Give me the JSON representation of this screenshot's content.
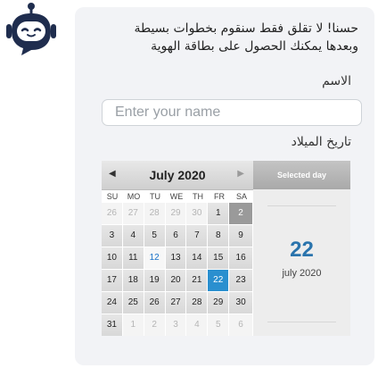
{
  "bot": {
    "avatar_icon": "robot-icon"
  },
  "message": {
    "line1": "حسنا! لا تقلق فقط سنقوم بخطوات بسيطة",
    "line2": "وبعدها يمكنك الحصول على بطاقة الهوية"
  },
  "form": {
    "name_label": "الاسم",
    "name_placeholder": "Enter your name",
    "birth_label": "تاريخ الميلاد"
  },
  "calendar": {
    "month_title": "July 2020",
    "prev_icon": "prev-month-icon",
    "next_icon": "next-month-icon",
    "weekdays": [
      "SU",
      "MO",
      "TU",
      "WE",
      "TH",
      "FR",
      "SA"
    ],
    "weeks": [
      [
        "26",
        "27",
        "28",
        "29",
        "30",
        "1",
        "2"
      ],
      [
        "3",
        "4",
        "5",
        "6",
        "7",
        "8",
        "9"
      ],
      [
        "10",
        "11",
        "12",
        "13",
        "14",
        "15",
        "16"
      ],
      [
        "17",
        "18",
        "19",
        "20",
        "21",
        "22",
        "23"
      ],
      [
        "24",
        "25",
        "26",
        "27",
        "28",
        "29",
        "30"
      ],
      [
        "31",
        "1",
        "2",
        "3",
        "4",
        "5",
        "6"
      ]
    ],
    "selected_header": "Selected day",
    "selected_day": "22",
    "selected_month": "july 2020"
  },
  "colors": {
    "bubble_bg": "#f2f3f6",
    "accent": "#2a8fcf",
    "bot_navy": "#1f2d4e"
  }
}
